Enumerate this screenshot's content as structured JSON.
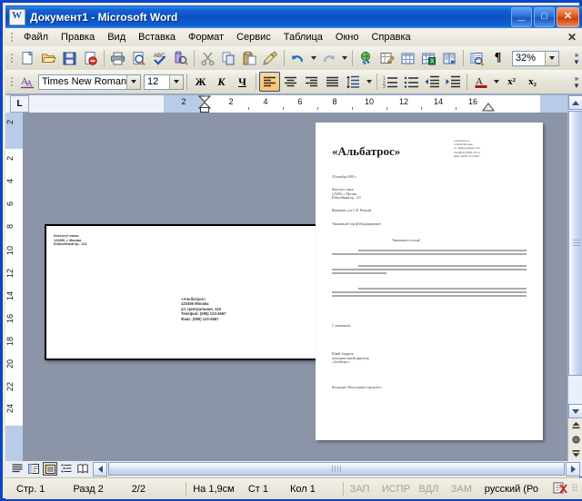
{
  "window": {
    "title": "Документ1 - Microsoft Word",
    "app_icon": "word-document-icon",
    "minimize_label": "_",
    "maximize_label": "□",
    "close_label": "✕",
    "document_close_label": "✕"
  },
  "menu": {
    "items": [
      {
        "label": "Файл"
      },
      {
        "label": "Правка"
      },
      {
        "label": "Вид"
      },
      {
        "label": "Вставка"
      },
      {
        "label": "Формат"
      },
      {
        "label": "Сервис"
      },
      {
        "label": "Таблица"
      },
      {
        "label": "Окно"
      },
      {
        "label": "Справка"
      }
    ]
  },
  "standard_toolbar": {
    "buttons": [
      {
        "name": "new-document-icon"
      },
      {
        "name": "open-folder-icon"
      },
      {
        "name": "save-icon"
      },
      {
        "name": "permission-icon"
      },
      {
        "name": "print-icon"
      },
      {
        "name": "print-preview-icon"
      },
      {
        "name": "spelling-check-icon"
      },
      {
        "name": "research-icon"
      },
      {
        "name": "cut-scissors-icon"
      },
      {
        "name": "copy-icon"
      },
      {
        "name": "paste-icon"
      },
      {
        "name": "format-painter-icon"
      },
      {
        "name": "undo-icon"
      },
      {
        "name": "redo-icon"
      },
      {
        "name": "hyperlink-icon"
      },
      {
        "name": "tables-and-borders-icon"
      },
      {
        "name": "insert-table-icon"
      },
      {
        "name": "insert-excel-sheet-icon"
      },
      {
        "name": "columns-icon"
      },
      {
        "name": "document-map-icon"
      },
      {
        "name": "show-formatting-marks-icon"
      }
    ],
    "show_marks_glyph": "¶",
    "zoom_value": "32%"
  },
  "formatting_toolbar": {
    "styles_icon": "styles-and-formatting-icon",
    "font_name": "Times New Roman",
    "font_size": "12",
    "bold_label": "Ж",
    "italic_label": "К",
    "underline_label": "Ч",
    "align_left_icon": "align-left-icon",
    "align_center_icon": "align-center-icon",
    "align_right_icon": "align-right-icon",
    "align_justify_icon": "align-justify-icon",
    "line_spacing_icon": "line-spacing-icon",
    "numbering_icon": "numbered-list-icon",
    "bullets_icon": "bulleted-list-icon",
    "decrease_indent_icon": "decrease-indent-icon",
    "increase_indent_icon": "increase-indent-icon",
    "font_color_label": "A",
    "superscript_label": "x²",
    "subscript_label": "x₂"
  },
  "ruler": {
    "tab_stop_label": "L",
    "horizontal_margin_label": "2",
    "horizontal_numbers": [
      "2",
      "4",
      "6",
      "8",
      "10",
      "12",
      "14",
      "16"
    ],
    "vertical_margin_label": "2",
    "vertical_numbers": [
      "2",
      "4",
      "6",
      "8",
      "10",
      "12",
      "14",
      "16",
      "18",
      "20",
      "22",
      "24"
    ]
  },
  "document": {
    "envelope_page": {
      "recipient": "Институт связи\n123456, г. Москва\nЮбилейный пр., 123",
      "sender": "«Альбатрос»\n123456 Москва\nул. Центральная, 123\nТелефон: (095) 123-4567\nФакс: (095) 123-4567"
    },
    "letter_page": {
      "title": "«Альбатрос»",
      "letterhead": "«Альбатрос»\n123456 Москва\nул. Центральная, 123\nТелефон: (095) 123-4\nФакс:  (095) 123-4567",
      "date": "29 октября 2001 г.",
      "recipient": "Институт связи\n123456, г. Москва\nЮбилейный пр., 123",
      "attention": "Внимание: д-р С.В. Петрова",
      "salutation": "Уважаемый Сергей Владимирович!",
      "heading": "Уважаемые господа!",
      "closing": "С уважением,",
      "signature": "Юрий Андреев,\nисполнительный директор\n«Альбатрос»",
      "enclosure": "Вложение: Итоги нашего прошлого"
    }
  },
  "view_buttons": [
    {
      "name": "normal-view-icon",
      "active": false
    },
    {
      "name": "web-layout-view-icon",
      "active": false
    },
    {
      "name": "print-layout-view-icon",
      "active": true
    },
    {
      "name": "outline-view-icon",
      "active": false
    },
    {
      "name": "reading-layout-view-icon",
      "active": false
    }
  ],
  "status_bar": {
    "page": "Стр. 1",
    "section": "Разд 2",
    "page_of": "2/2",
    "at": "На 1,9см",
    "line": "Ст 1",
    "column": "Кол 1",
    "rec": "ЗАП",
    "trk": "ИСПР",
    "ext": "ВДЛ",
    "ovr": "ЗАМ",
    "language": "русский (Ро",
    "spellcheck_icon": "spelling-status-icon"
  },
  "colors": {
    "title_bar": "#0b50c4",
    "close_button": "#c63e0a",
    "toolbar": "#e7e5d8",
    "page_background": "#8c94a8",
    "active_button": "#ffc268"
  }
}
